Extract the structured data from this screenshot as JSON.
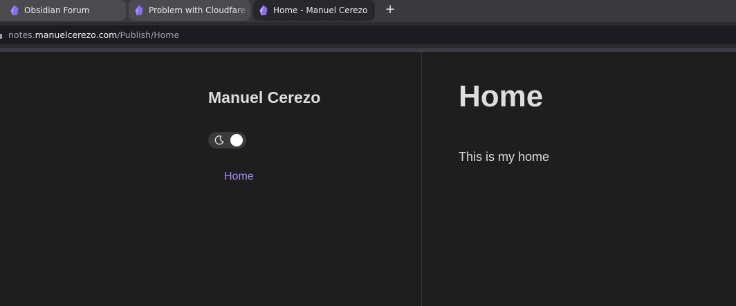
{
  "browser": {
    "tabs": [
      {
        "title": "Obsidian Forum",
        "active": false,
        "icon": "obsidian-icon"
      },
      {
        "title": "Problem with Cloudfare cus",
        "active": false,
        "icon": "obsidian-icon"
      },
      {
        "title": "Home - Manuel Cerezo",
        "active": true,
        "icon": "obsidian-icon"
      }
    ],
    "new_tab_label": "+",
    "url": {
      "prefix": "notes.",
      "domain": "manuelcerezo.com",
      "path": "/Publish/Home"
    }
  },
  "sidebar": {
    "site_name": "Manuel Cerezo",
    "theme_toggle": {
      "icon": "moon-icon",
      "mode": "dark"
    },
    "nav_items": [
      {
        "label": "Home",
        "active": true
      }
    ]
  },
  "main": {
    "title": "Home",
    "body": "This is my home"
  },
  "colors": {
    "background": "#1e1e1e",
    "text": "#dcddde",
    "accent": "#a88bfa",
    "icon_purple": "#8b6cef"
  }
}
